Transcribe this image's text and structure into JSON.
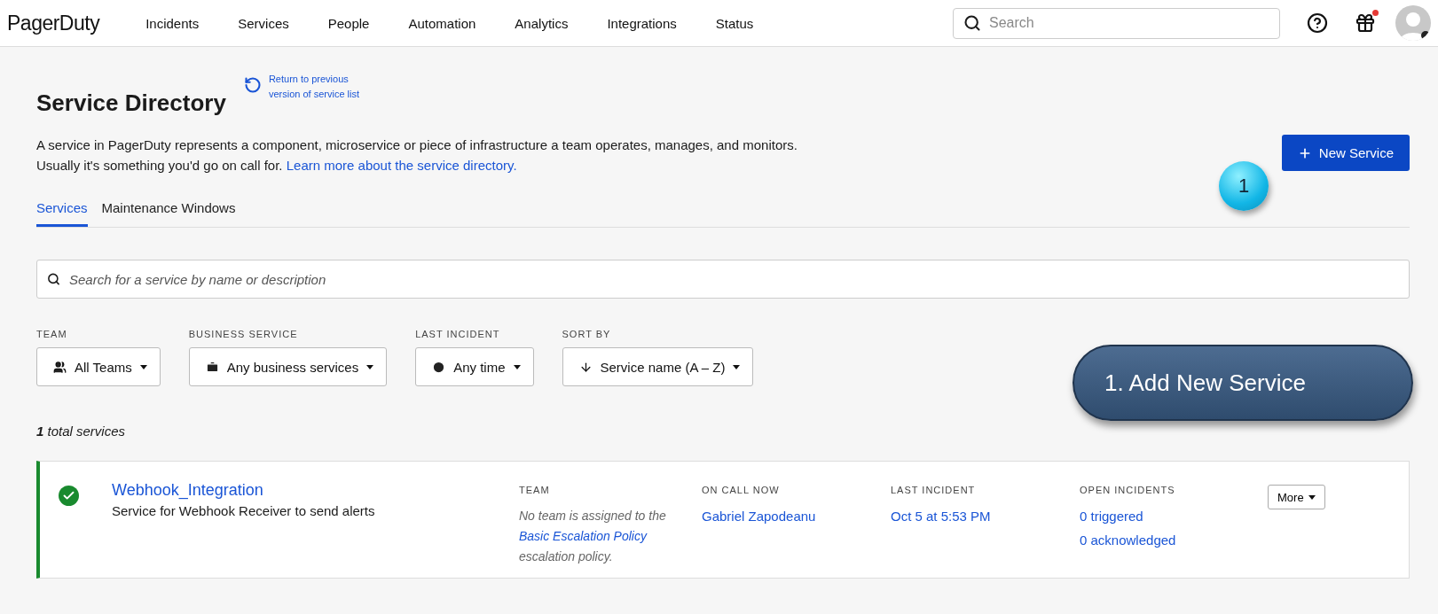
{
  "header": {
    "logo": "PagerDuty",
    "nav": [
      "Incidents",
      "Services",
      "People",
      "Automation",
      "Analytics",
      "Integrations",
      "Status"
    ],
    "search": {
      "placeholder": "Search"
    },
    "gift_has_notification": true
  },
  "page": {
    "title": "Service Directory",
    "return_link": "Return to previous version of service list",
    "description_line1": "A service in PagerDuty represents a component, microservice or piece of infrastructure a team operates, manages, and monitors.",
    "description_line2": "Usually it's something you'd go on call for.",
    "learn_more_link": "Learn more about the service directory.",
    "new_service_button": "New Service"
  },
  "tabs": [
    {
      "label": "Services",
      "selected": true
    },
    {
      "label": "Maintenance Windows",
      "selected": false
    }
  ],
  "service_search": {
    "placeholder": "Search for a service by name or description"
  },
  "filters": [
    {
      "kind": "team",
      "label": "TEAM",
      "value": "All Teams"
    },
    {
      "kind": "business",
      "label": "BUSINESS SERVICE",
      "value": "Any business services"
    },
    {
      "kind": "time",
      "label": "LAST INCIDENT",
      "value": "Any time"
    },
    {
      "kind": "sort",
      "label": "SORT BY",
      "value": "Service name (A – Z)"
    }
  ],
  "total": "**1** total services",
  "services": [
    {
      "healthy": true,
      "name": "Webhook_Integration",
      "description": "Service for Webhook Receiver to send alerts",
      "team_label": "TEAM",
      "team_text_before": "No team is assigned to the",
      "team_link": "Basic Escalation Policy",
      "team_text_after": "escalation policy.",
      "on_call_label": "ON CALL NOW",
      "on_call": "Gabriel Zapodeanu",
      "last_incident_label": "LAST INCIDENT",
      "last_incident": "Oct 5 at 5:53 PM",
      "open_label": "OPEN INCIDENTS",
      "triggered": "0 triggered",
      "acknowledged": "0 acknowledged",
      "more_button": "More"
    }
  ],
  "annotations": {
    "marker": "1",
    "callout": "1. Add New Service"
  }
}
